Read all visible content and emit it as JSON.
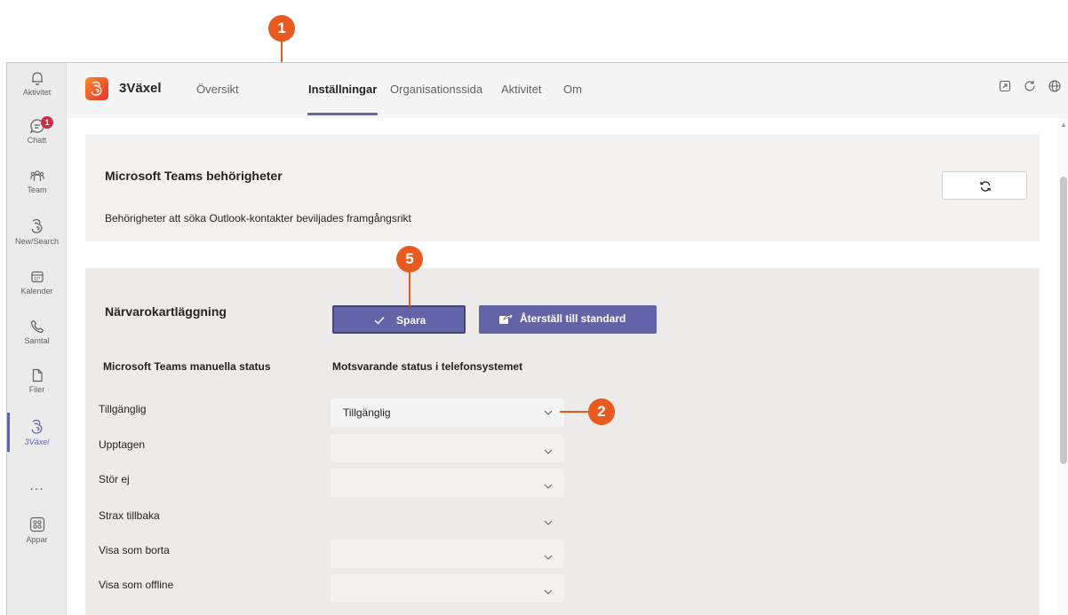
{
  "rail": {
    "items": [
      {
        "label": "Aktivitet",
        "icon": "bell-icon"
      },
      {
        "label": "Chatt",
        "icon": "chat-icon",
        "badge": "1"
      },
      {
        "label": "Team",
        "icon": "team-icon"
      },
      {
        "label": "New/Search",
        "icon": "three-logo-icon"
      },
      {
        "label": "Kalender",
        "icon": "calendar-icon"
      },
      {
        "label": "Samtal",
        "icon": "phone-icon"
      },
      {
        "label": "Filer",
        "icon": "file-icon"
      },
      {
        "label": "3Växel",
        "icon": "three-logo-icon"
      },
      {
        "label": "Appar",
        "icon": "apps-icon"
      }
    ],
    "more": "..."
  },
  "header": {
    "app_title": "3Växel",
    "tabs": [
      {
        "label": "Översikt"
      },
      {
        "label": "Inställningar"
      },
      {
        "label": "Organisationssida"
      },
      {
        "label": "Aktivitet"
      },
      {
        "label": "Om"
      }
    ],
    "active_tab": "Inställningar"
  },
  "permissions": {
    "title": "Microsoft Teams behörigheter",
    "message": "Behörigheter att söka Outlook-kontakter beviljades framgångsrikt"
  },
  "presence": {
    "title": "Närvarokartläggning",
    "save_label": "Spara",
    "reset_label": "Återställ till standard",
    "col_left": "Microsoft Teams manuella status",
    "col_right": "Motsvarande status i telefonsystemet",
    "rows": [
      {
        "label": "Tillgänglig",
        "value": "Tillgänglig"
      },
      {
        "label": "Upptagen",
        "value": ""
      },
      {
        "label": "Stör ej",
        "value": ""
      },
      {
        "label": "Strax tillbaka",
        "value": ""
      },
      {
        "label": "Visa som borta",
        "value": ""
      },
      {
        "label": "Visa som offline",
        "value": ""
      }
    ]
  },
  "callouts": {
    "c1": "1",
    "c2": "2",
    "c5": "5"
  },
  "colors": {
    "accent": "#6264a7",
    "callout": "#e85a1f",
    "badge": "#c4314b"
  }
}
